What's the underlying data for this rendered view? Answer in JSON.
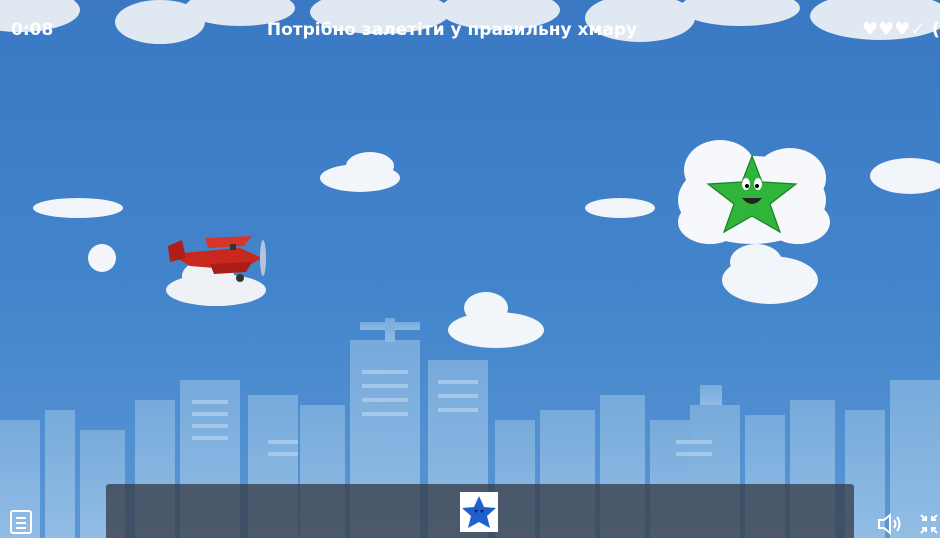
{
  "hud": {
    "timer": "0:08",
    "instruction": "Потрібно залетіти у правильну хмару",
    "lives_display": "♥♥♥✓ ("
  },
  "target": {
    "shape": "star",
    "color": "#1f5fd0"
  },
  "options": [
    {
      "shape": "star",
      "color": "#2fb53a"
    }
  ],
  "colors": {
    "sky": "#3d7fc7",
    "plane": "#c8281e",
    "bar": "#3a4048"
  },
  "icons": [
    "menu-icon",
    "speaker-icon",
    "fullscreen-exit-icon"
  ]
}
